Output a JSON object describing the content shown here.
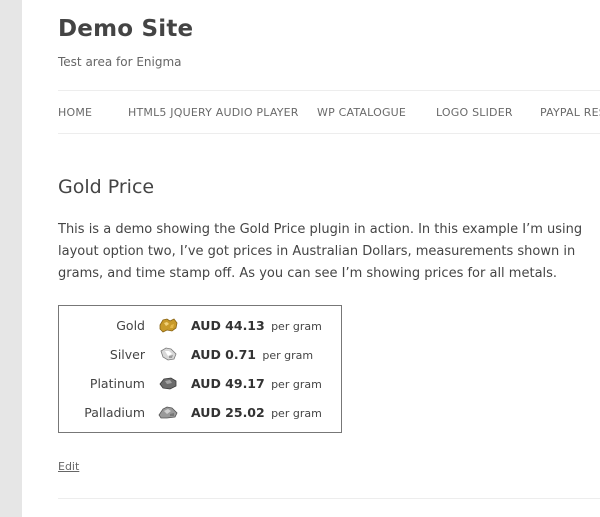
{
  "site": {
    "title": "Demo Site",
    "description": "Test area for Enigma"
  },
  "nav": {
    "items": [
      "HOME",
      "HTML5 JQUERY AUDIO PLAYER",
      "WP CATALOGUE",
      "LOGO SLIDER",
      "PAYPAL RES"
    ]
  },
  "entry": {
    "title": "Gold Price",
    "text": "This is a demo showing the Gold Price plugin in action. In this example I’m using layout option two, I’ve got prices in Australian Dollars, measurements shown in grams, and time stamp off. As you can see I’m showing prices for all metals."
  },
  "prices": {
    "unit_label": "per gram",
    "rows": [
      {
        "metal": "Gold",
        "price": "AUD 44.13",
        "icon": "gold-nugget-icon"
      },
      {
        "metal": "Silver",
        "price": "AUD 0.71",
        "icon": "silver-nugget-icon"
      },
      {
        "metal": "Platinum",
        "price": "AUD 49.17",
        "icon": "platinum-nugget-icon"
      },
      {
        "metal": "Palladium",
        "price": "AUD 25.02",
        "icon": "palladium-nugget-icon"
      }
    ]
  },
  "edit_label": "Edit",
  "colors": {
    "gold": "#c89a2a",
    "silver": "#9a9a9a",
    "platinum": "#6d6d6d",
    "palladium": "#8e8e8e"
  }
}
